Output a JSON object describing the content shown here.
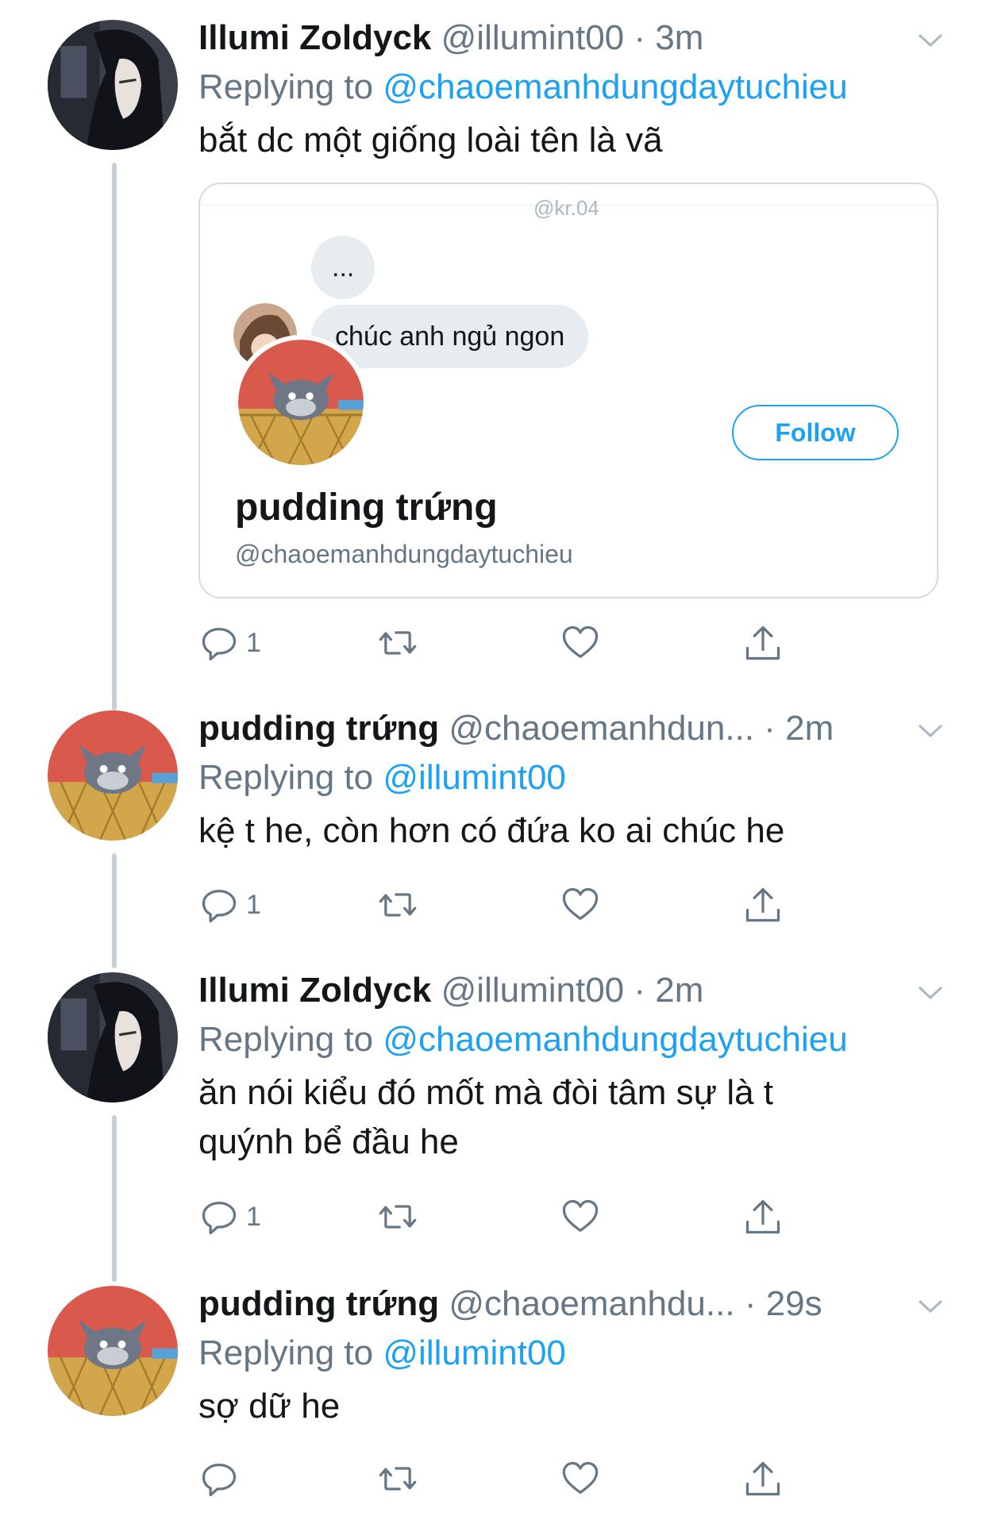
{
  "tweets": [
    {
      "name": "Illumi Zoldyck",
      "handle": "@illumint00",
      "time": "· 3m",
      "replying_prefix": "Replying to",
      "replying_to": "@chaoemanhdungdaytuchieu",
      "text": "bắt dc một giống loài tên là vã",
      "reply_count": "1",
      "avatar": "illumi-avatar"
    },
    {
      "name": "pudding trứng",
      "handle": "@chaoemanhdun...",
      "time": "· 2m",
      "replying_prefix": "Replying to",
      "replying_to": "@illumint00",
      "text": "kệ t he, còn hơn có đứa ko ai chúc he",
      "reply_count": "1",
      "avatar": "tom-cat-avatar"
    },
    {
      "name": "Illumi Zoldyck",
      "handle": "@illumint00",
      "time": "· 2m",
      "replying_prefix": "Replying to",
      "replying_to": "@chaoemanhdungdaytuchieu",
      "text": "ăn nói kiểu đó mốt mà đòi tâm sự là t quýnh bể đầu he",
      "reply_count": "1",
      "avatar": "illumi-avatar"
    },
    {
      "name": "pudding trứng",
      "handle": "@chaoemanhdu...",
      "time": "· 29s",
      "replying_prefix": "Replying to",
      "replying_to": "@illumint00",
      "text": "sợ dữ he",
      "reply_count": "",
      "avatar": "tom-cat-avatar"
    }
  ],
  "embed": {
    "top_text": "@kr.04",
    "bubble_1": "...",
    "bubble_2": "chúc anh ngủ ngon",
    "follow_label": "Follow",
    "profile_name": "pudding trứng",
    "profile_handle": "@chaoemanhdungdaytuchieu"
  },
  "colors": {
    "accent": "#1da1f2",
    "secondary_text": "#657786",
    "thread_line": "#c4cfd6"
  }
}
